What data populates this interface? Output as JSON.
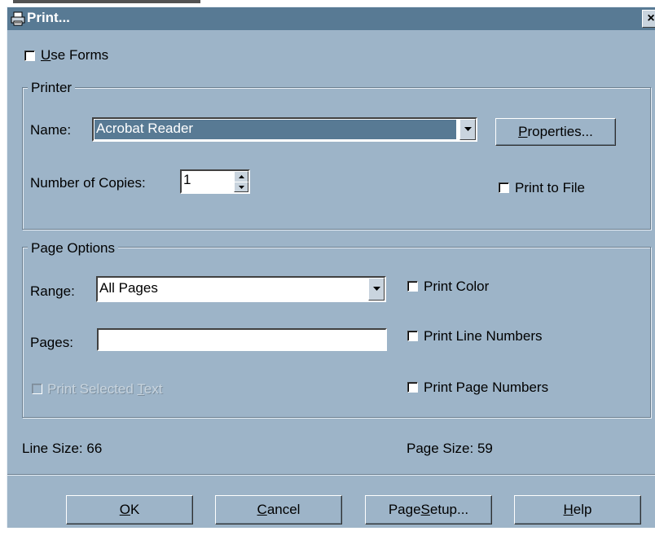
{
  "window": {
    "title": "Print...",
    "close_label": "×"
  },
  "use_forms": {
    "label_prefix": "",
    "label_ul": "U",
    "label_rest": "se Forms",
    "checked": false
  },
  "printer": {
    "group_title": "Printer",
    "name_label": "Name:",
    "name_value": "Acrobat Reader",
    "properties_prefix": "",
    "properties_ul": "P",
    "properties_rest": "roperties...",
    "copies_label": "Number of Copies:",
    "copies_value": "1",
    "print_to_file_label": "Print to File",
    "print_to_file_checked": false
  },
  "page_options": {
    "group_title": "Page Options",
    "range_label": "Range:",
    "range_value": "All Pages",
    "pages_label": "Pages:",
    "pages_value": "",
    "print_selected_prefix": "Print Selected ",
    "print_selected_ul": "T",
    "print_selected_rest": "ext",
    "print_color_label": "Print Color",
    "print_line_numbers_label": "Print Line Numbers",
    "print_page_numbers_label": "Print Page Numbers"
  },
  "info": {
    "line_size": "Line Size: 66",
    "page_size": "Page Size: 59"
  },
  "buttons": {
    "ok_ul": "O",
    "ok_rest": "K",
    "cancel_ul": "C",
    "cancel_rest": "ancel",
    "page_setup_prefix": "Page ",
    "page_setup_ul": "S",
    "page_setup_rest": "etup...",
    "help_ul": "H",
    "help_rest": "elp"
  },
  "colors": {
    "dialog_bg": "#9db4c8",
    "titlebar": "#587a94",
    "selection": "#587a94"
  }
}
